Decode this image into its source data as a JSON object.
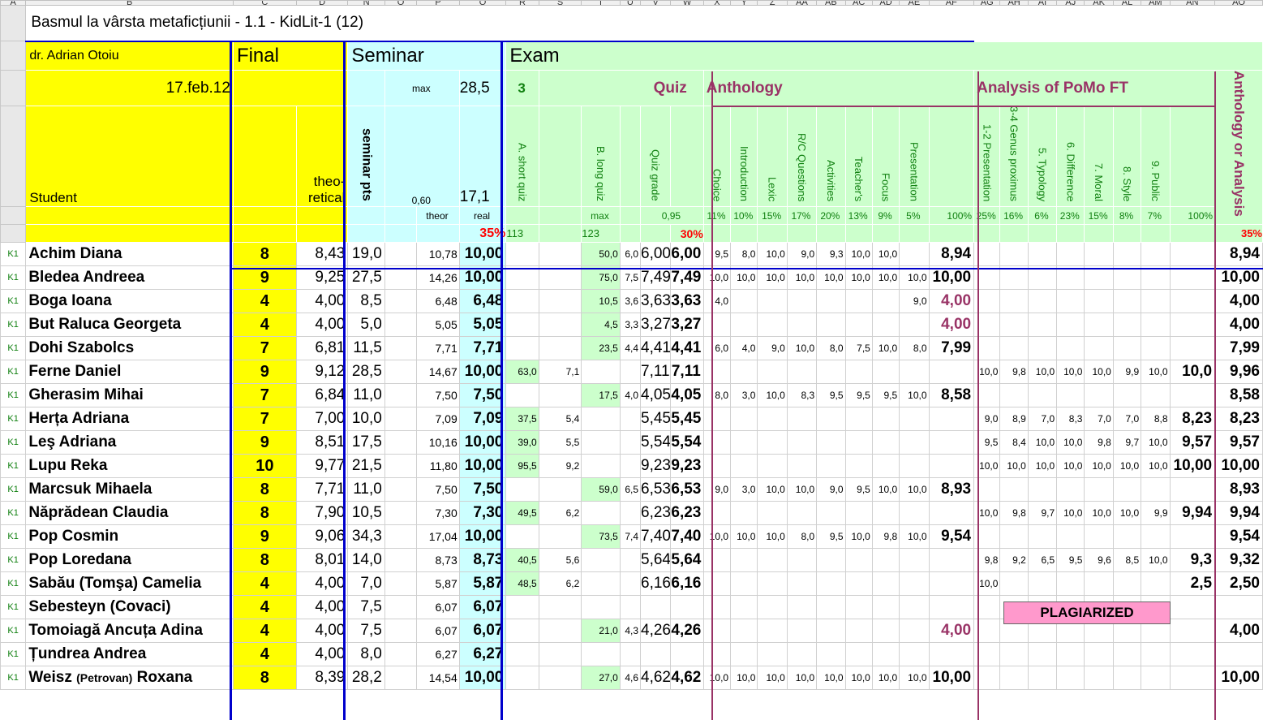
{
  "title": "Basmul la vârsta metaficțiunii - 1.1 - KidLit-1 (12)",
  "teacher": "dr. Adrian Otoiu",
  "date": "17.feb.12",
  "headers": {
    "student": "Student",
    "final": "Final",
    "theoretical_1": "theo-",
    "theoretical_2": "retical",
    "seminar": "Seminar",
    "exam": "Exam",
    "max_label": "max",
    "max_value": "28,5",
    "seminar_pts": "seminar pts",
    "sem_factor": "0,60",
    "sem_theor_val": "17,1",
    "theor": "theor",
    "real": "real",
    "sem_weight": "35%",
    "quiz_no": "3",
    "quiz": "Quiz",
    "short_quiz": "A. short quiz",
    "long_quiz": "B. long quiz",
    "quiz_grade": "Quiz grade",
    "quiz_max": "max",
    "quiz_factor": "0,95",
    "short_max": "113",
    "long_max": "123",
    "quiz_weight": "30%",
    "anthology": "Anthology",
    "analysis": "Analysis of PoMo FT",
    "anth_or_analysis": "Anthology or Analysis",
    "final_weight": "35%",
    "anth_cols": [
      {
        "label": "Choice",
        "pct": "11%"
      },
      {
        "label": "Introduction",
        "pct": "10%"
      },
      {
        "label": "Lexic",
        "pct": "15%"
      },
      {
        "label": "R/C Questions",
        "pct": "17%"
      },
      {
        "label": "Activities",
        "pct": "20%"
      },
      {
        "label": "Teacher's",
        "pct": "13%"
      },
      {
        "label": "Focus",
        "pct": "9%"
      },
      {
        "label": "Presentation",
        "pct": "5%"
      }
    ],
    "anth_total": "100%",
    "an_cols": [
      {
        "label": "1-2 Presentation",
        "pct": "25%"
      },
      {
        "label": "3-4 Genus proximus",
        "pct": "16%"
      },
      {
        "label": "5. Typology",
        "pct": "6%"
      },
      {
        "label": "6. Difference",
        "pct": "23%"
      },
      {
        "label": "7. Moral",
        "pct": "15%"
      },
      {
        "label": "8. Style",
        "pct": "8%"
      },
      {
        "label": "9. Public",
        "pct": "7%"
      }
    ],
    "an_total": "100%"
  },
  "col_letters": [
    "A",
    "B",
    "C",
    "D",
    "N",
    "O",
    "P",
    "Q",
    "R",
    "S",
    "T",
    "U",
    "V",
    "W",
    "X",
    "Y",
    "Z",
    "AA",
    "AB",
    "AC",
    "AD",
    "AE",
    "AF",
    "AG",
    "AH",
    "AI",
    "AJ",
    "AK",
    "AL",
    "AM",
    "AN",
    "AO"
  ],
  "rows": [
    {
      "k": "K1",
      "name": "Achim Diana",
      "final": "8",
      "theo": "8,43",
      "sem": "19,0",
      "th": "10,78",
      "real": "10,00",
      "sa": "",
      "sp": "",
      "la": "50,0",
      "lp": "6,0",
      "qg": "6,00",
      "qgb": "6,00",
      "anth": [
        "9,5",
        "8,0",
        "10,0",
        "9,0",
        "9,3",
        "10,0",
        "10,0",
        ""
      ],
      "at": "8,94",
      "an": [
        "",
        "",
        "",
        "",
        "",
        "",
        ""
      ],
      "ant": "",
      "fin": "8,94"
    },
    {
      "k": "K1",
      "name": "Bledea Andreea",
      "final": "9",
      "theo": "9,25",
      "sem": "27,5",
      "th": "14,26",
      "real": "10,00",
      "sa": "",
      "sp": "",
      "la": "75,0",
      "lp": "7,5",
      "qg": "7,49",
      "qgb": "7,49",
      "anth": [
        "10,0",
        "10,0",
        "10,0",
        "10,0",
        "10,0",
        "10,0",
        "10,0",
        "10,0"
      ],
      "at": "10,00",
      "an": [
        "",
        "",
        "",
        "",
        "",
        "",
        ""
      ],
      "ant": "",
      "fin": "10,00"
    },
    {
      "k": "K1",
      "name": "Boga Ioana",
      "final": "4",
      "theo": "4,00",
      "sem": "8,5",
      "th": "6,48",
      "real": "6,48",
      "sa": "",
      "sp": "",
      "la": "10,5",
      "lp": "3,6",
      "qg": "3,63",
      "qgb": "3,63",
      "anth": [
        "4,0",
        "",
        "",
        "",
        "",
        "",
        "",
        "9,0"
      ],
      "at": "4,00",
      "atp": true,
      "an": [
        "",
        "",
        "",
        "",
        "",
        "",
        ""
      ],
      "ant": "",
      "fin": "4,00"
    },
    {
      "k": "K1",
      "name": "But Raluca Georgeta",
      "final": "4",
      "theo": "4,00",
      "sem": "5,0",
      "th": "5,05",
      "real": "5,05",
      "sa": "",
      "sp": "",
      "la": "4,5",
      "lp": "3,3",
      "qg": "3,27",
      "qgb": "3,27",
      "anth": [
        "",
        "",
        "",
        "",
        "",
        "",
        "",
        ""
      ],
      "at": "4,00",
      "atp": true,
      "an": [
        "",
        "",
        "",
        "",
        "",
        "",
        ""
      ],
      "ant": "",
      "fin": "4,00"
    },
    {
      "k": "K1",
      "name": "Dohi Szabolcs",
      "final": "7",
      "theo": "6,81",
      "sem": "11,5",
      "th": "7,71",
      "real": "7,71",
      "sa": "",
      "sp": "",
      "la": "23,5",
      "lp": "4,4",
      "qg": "4,41",
      "qgb": "4,41",
      "anth": [
        "6,0",
        "4,0",
        "9,0",
        "10,0",
        "8,0",
        "7,5",
        "10,0",
        "8,0"
      ],
      "at": "7,99",
      "an": [
        "",
        "",
        "",
        "",
        "",
        "",
        ""
      ],
      "ant": "",
      "fin": "7,99"
    },
    {
      "k": "K1",
      "name": "Ferne Daniel",
      "final": "9",
      "theo": "9,12",
      "sem": "28,5",
      "th": "14,67",
      "real": "10,00",
      "sa": "63,0",
      "sp": "7,1",
      "la": "",
      "lp": "",
      "qg": "7,11",
      "qgb": "7,11",
      "anth": [
        "",
        "",
        "",
        "",
        "",
        "",
        "",
        ""
      ],
      "at": "",
      "an": [
        "10,0",
        "9,8",
        "10,0",
        "10,0",
        "10,0",
        "9,9",
        "10,0"
      ],
      "ant": "10,0",
      "fin": "9,96"
    },
    {
      "k": "K1",
      "name": "Gherasim Mihai",
      "final": "7",
      "theo": "6,84",
      "sem": "11,0",
      "th": "7,50",
      "real": "7,50",
      "sa": "",
      "sp": "",
      "la": "17,5",
      "lp": "4,0",
      "qg": "4,05",
      "qgb": "4,05",
      "anth": [
        "8,0",
        "3,0",
        "10,0",
        "8,3",
        "9,5",
        "9,5",
        "9,5",
        "10,0"
      ],
      "at": "8,58",
      "an": [
        "",
        "",
        "",
        "",
        "",
        "",
        ""
      ],
      "ant": "",
      "fin": "8,58"
    },
    {
      "k": "K1",
      "name": "Herța Adriana",
      "final": "7",
      "theo": "7,00",
      "sem": "10,0",
      "th": "7,09",
      "real": "7,09",
      "sa": "37,5",
      "sp": "5,4",
      "la": "",
      "lp": "",
      "qg": "5,45",
      "qgb": "5,45",
      "anth": [
        "",
        "",
        "",
        "",
        "",
        "",
        "",
        ""
      ],
      "at": "",
      "an": [
        "9,0",
        "8,9",
        "7,0",
        "8,3",
        "7,0",
        "7,0",
        "8,8"
      ],
      "ant": "8,23",
      "fin": "8,23"
    },
    {
      "k": "K1",
      "name": "Leş Adriana",
      "final": "9",
      "theo": "8,51",
      "sem": "17,5",
      "th": "10,16",
      "real": "10,00",
      "sa": "39,0",
      "sp": "5,5",
      "la": "",
      "lp": "",
      "qg": "5,54",
      "qgb": "5,54",
      "anth": [
        "",
        "",
        "",
        "",
        "",
        "",
        "",
        ""
      ],
      "at": "",
      "an": [
        "9,5",
        "8,4",
        "10,0",
        "10,0",
        "9,8",
        "9,7",
        "10,0"
      ],
      "ant": "9,57",
      "fin": "9,57"
    },
    {
      "k": "K1",
      "name": "Lupu Reka",
      "final": "10",
      "theo": "9,77",
      "sem": "21,5",
      "th": "11,80",
      "real": "10,00",
      "sa": "95,5",
      "sp": "9,2",
      "la": "",
      "lp": "",
      "qg": "9,23",
      "qgb": "9,23",
      "anth": [
        "",
        "",
        "",
        "",
        "",
        "",
        "",
        ""
      ],
      "at": "",
      "an": [
        "10,0",
        "10,0",
        "10,0",
        "10,0",
        "10,0",
        "10,0",
        "10,0"
      ],
      "ant": "10,00",
      "fin": "10,00"
    },
    {
      "k": "K1",
      "name": "Marcsuk Mihaela",
      "final": "8",
      "theo": "7,71",
      "sem": "11,0",
      "th": "7,50",
      "real": "7,50",
      "sa": "",
      "sp": "",
      "la": "59,0",
      "lp": "6,5",
      "qg": "6,53",
      "qgb": "6,53",
      "anth": [
        "9,0",
        "3,0",
        "10,0",
        "10,0",
        "9,0",
        "9,5",
        "10,0",
        "10,0"
      ],
      "at": "8,93",
      "an": [
        "",
        "",
        "",
        "",
        "",
        "",
        ""
      ],
      "ant": "",
      "fin": "8,93"
    },
    {
      "k": "K1",
      "name": "Năprădean Claudia",
      "final": "8",
      "theo": "7,90",
      "sem": "10,5",
      "th": "7,30",
      "real": "7,30",
      "sa": "49,5",
      "sp": "6,2",
      "la": "",
      "lp": "",
      "qg": "6,23",
      "qgb": "6,23",
      "anth": [
        "",
        "",
        "",
        "",
        "",
        "",
        "",
        ""
      ],
      "at": "",
      "an": [
        "10,0",
        "9,8",
        "9,7",
        "10,0",
        "10,0",
        "10,0",
        "9,9"
      ],
      "ant": "9,94",
      "fin": "9,94"
    },
    {
      "k": "K1",
      "name": "Pop Cosmin",
      "final": "9",
      "theo": "9,06",
      "sem": "34,3",
      "th": "17,04",
      "real": "10,00",
      "sa": "",
      "sp": "",
      "la": "73,5",
      "lp": "7,4",
      "qg": "7,40",
      "qgb": "7,40",
      "anth": [
        "10,0",
        "10,0",
        "10,0",
        "8,0",
        "9,5",
        "10,0",
        "9,8",
        "10,0"
      ],
      "at": "9,54",
      "an": [
        "",
        "",
        "",
        "",
        "",
        "",
        ""
      ],
      "ant": "",
      "fin": "9,54"
    },
    {
      "k": "K1",
      "name": "Pop Loredana",
      "final": "8",
      "theo": "8,01",
      "sem": "14,0",
      "th": "8,73",
      "real": "8,73",
      "sa": "40,5",
      "sp": "5,6",
      "la": "",
      "lp": "",
      "qg": "5,64",
      "qgb": "5,64",
      "anth": [
        "",
        "",
        "",
        "",
        "",
        "",
        "",
        ""
      ],
      "at": "",
      "an": [
        "9,8",
        "9,2",
        "6,5",
        "9,5",
        "9,6",
        "8,5",
        "10,0"
      ],
      "ant": "9,3",
      "fin": "9,32"
    },
    {
      "k": "K1",
      "name": "Sabău (Tomşa) Camelia",
      "final": "4",
      "theo": "4,00",
      "sem": "7,0",
      "th": "5,87",
      "real": "5,87",
      "sa": "48,5",
      "sp": "6,2",
      "la": "",
      "lp": "",
      "qg": "6,16",
      "qgb": "6,16",
      "anth": [
        "",
        "",
        "",
        "",
        "",
        "",
        "",
        ""
      ],
      "at": "",
      "an": [
        "10,0",
        "",
        "",
        "",
        "",
        "",
        ""
      ],
      "ant": "2,5",
      "fin": "2,50"
    },
    {
      "k": "K1",
      "name": "Sebesteyn (Covaci)",
      "final": "4",
      "theo": "4,00",
      "sem": "7,5",
      "th": "6,07",
      "real": "6,07",
      "sa": "",
      "sp": "",
      "la": "",
      "lp": "",
      "qg": "",
      "qgb": "",
      "anth": [
        "",
        "",
        "",
        "",
        "",
        "",
        "",
        ""
      ],
      "at": "",
      "an": [
        "",
        "",
        "",
        "",
        "",
        "",
        ""
      ],
      "ant": "",
      "fin": ""
    },
    {
      "k": "K1",
      "name": "Tomoiagă Ancuța Adina",
      "final": "4",
      "theo": "4,00",
      "sem": "7,5",
      "th": "6,07",
      "real": "6,07",
      "sa": "",
      "sp": "",
      "la": "21,0",
      "lp": "4,3",
      "qg": "4,26",
      "qgb": "4,26",
      "anth": [
        "",
        "",
        "",
        "",
        "",
        "",
        "",
        ""
      ],
      "at": "4,00",
      "atp": true,
      "an": [
        "",
        "",
        "",
        "",
        "",
        "",
        ""
      ],
      "ant": "",
      "fin": "4,00"
    },
    {
      "k": "K1",
      "name": "Țundrea Andrea",
      "final": "4",
      "theo": "4,00",
      "sem": "8,0",
      "th": "6,27",
      "real": "6,27",
      "sa": "",
      "sp": "",
      "la": "",
      "lp": "",
      "qg": "",
      "qgb": "",
      "anth": [
        "",
        "",
        "",
        "",
        "",
        "",
        "",
        ""
      ],
      "at": "",
      "an": [
        "",
        "",
        "",
        "",
        "",
        "",
        ""
      ],
      "ant": "",
      "fin": ""
    },
    {
      "k": "K1",
      "name": "Weisz",
      "name_sm": "(Petrovan)",
      "name2": "Roxana",
      "final": "8",
      "theo": "8,39",
      "sem": "28,2",
      "th": "14,54",
      "real": "10,00",
      "sa": "",
      "sp": "",
      "la": "27,0",
      "lp": "4,6",
      "qg": "4,62",
      "qgb": "4,62",
      "anth": [
        "10,0",
        "10,0",
        "10,0",
        "10,0",
        "10,0",
        "10,0",
        "10,0",
        "10,0"
      ],
      "at": "10,00",
      "an": [
        "",
        "",
        "",
        "",
        "",
        "",
        ""
      ],
      "ant": "",
      "fin": "10,00"
    }
  ],
  "plagiarized": "PLAGIARIZED"
}
